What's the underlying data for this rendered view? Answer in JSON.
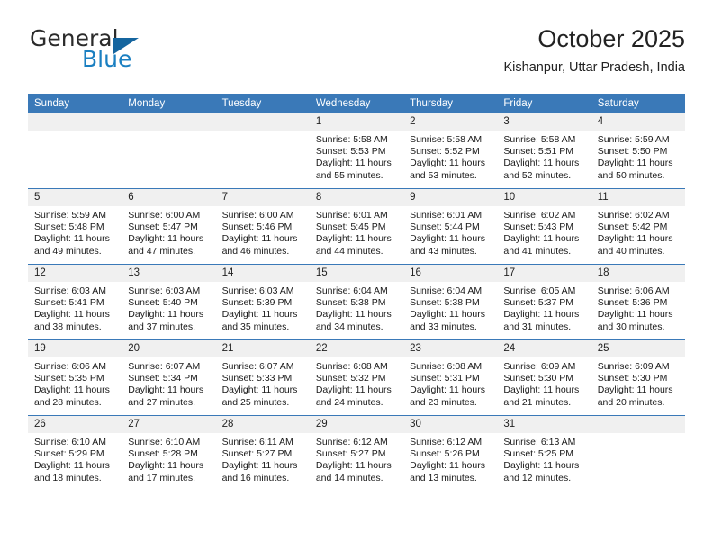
{
  "brand": {
    "name_top": "General",
    "name_bottom": "Blue",
    "triangle_icon": "triangle-logo-icon",
    "color_blue": "#1a7fc1",
    "color_dark": "#2b2b2b"
  },
  "header": {
    "title": "October 2025",
    "location": "Kishanpur, Uttar Pradesh, India"
  },
  "theme": {
    "header_bg": "#3a79b8",
    "daynum_bg": "#f0f0f0",
    "grid_line": "#3a79b8",
    "text": "#1a1a1a"
  },
  "weekday_headers": [
    "Sunday",
    "Monday",
    "Tuesday",
    "Wednesday",
    "Thursday",
    "Friday",
    "Saturday"
  ],
  "labels": {
    "sunrise_prefix": "Sunrise:",
    "sunset_prefix": "Sunset:",
    "daylight_prefix": "Daylight:"
  },
  "weeks": [
    [
      {
        "day": "",
        "sunrise": "",
        "sunset": "",
        "daylight": "",
        "empty": true
      },
      {
        "day": "",
        "sunrise": "",
        "sunset": "",
        "daylight": "",
        "empty": true
      },
      {
        "day": "",
        "sunrise": "",
        "sunset": "",
        "daylight": "",
        "empty": true
      },
      {
        "day": "1",
        "sunrise": "Sunrise: 5:58 AM",
        "sunset": "Sunset: 5:53 PM",
        "daylight": "Daylight: 11 hours and 55 minutes.",
        "empty": false
      },
      {
        "day": "2",
        "sunrise": "Sunrise: 5:58 AM",
        "sunset": "Sunset: 5:52 PM",
        "daylight": "Daylight: 11 hours and 53 minutes.",
        "empty": false
      },
      {
        "day": "3",
        "sunrise": "Sunrise: 5:58 AM",
        "sunset": "Sunset: 5:51 PM",
        "daylight": "Daylight: 11 hours and 52 minutes.",
        "empty": false
      },
      {
        "day": "4",
        "sunrise": "Sunrise: 5:59 AM",
        "sunset": "Sunset: 5:50 PM",
        "daylight": "Daylight: 11 hours and 50 minutes.",
        "empty": false
      }
    ],
    [
      {
        "day": "5",
        "sunrise": "Sunrise: 5:59 AM",
        "sunset": "Sunset: 5:48 PM",
        "daylight": "Daylight: 11 hours and 49 minutes.",
        "empty": false
      },
      {
        "day": "6",
        "sunrise": "Sunrise: 6:00 AM",
        "sunset": "Sunset: 5:47 PM",
        "daylight": "Daylight: 11 hours and 47 minutes.",
        "empty": false
      },
      {
        "day": "7",
        "sunrise": "Sunrise: 6:00 AM",
        "sunset": "Sunset: 5:46 PM",
        "daylight": "Daylight: 11 hours and 46 minutes.",
        "empty": false
      },
      {
        "day": "8",
        "sunrise": "Sunrise: 6:01 AM",
        "sunset": "Sunset: 5:45 PM",
        "daylight": "Daylight: 11 hours and 44 minutes.",
        "empty": false
      },
      {
        "day": "9",
        "sunrise": "Sunrise: 6:01 AM",
        "sunset": "Sunset: 5:44 PM",
        "daylight": "Daylight: 11 hours and 43 minutes.",
        "empty": false
      },
      {
        "day": "10",
        "sunrise": "Sunrise: 6:02 AM",
        "sunset": "Sunset: 5:43 PM",
        "daylight": "Daylight: 11 hours and 41 minutes.",
        "empty": false
      },
      {
        "day": "11",
        "sunrise": "Sunrise: 6:02 AM",
        "sunset": "Sunset: 5:42 PM",
        "daylight": "Daylight: 11 hours and 40 minutes.",
        "empty": false
      }
    ],
    [
      {
        "day": "12",
        "sunrise": "Sunrise: 6:03 AM",
        "sunset": "Sunset: 5:41 PM",
        "daylight": "Daylight: 11 hours and 38 minutes.",
        "empty": false
      },
      {
        "day": "13",
        "sunrise": "Sunrise: 6:03 AM",
        "sunset": "Sunset: 5:40 PM",
        "daylight": "Daylight: 11 hours and 37 minutes.",
        "empty": false
      },
      {
        "day": "14",
        "sunrise": "Sunrise: 6:03 AM",
        "sunset": "Sunset: 5:39 PM",
        "daylight": "Daylight: 11 hours and 35 minutes.",
        "empty": false
      },
      {
        "day": "15",
        "sunrise": "Sunrise: 6:04 AM",
        "sunset": "Sunset: 5:38 PM",
        "daylight": "Daylight: 11 hours and 34 minutes.",
        "empty": false
      },
      {
        "day": "16",
        "sunrise": "Sunrise: 6:04 AM",
        "sunset": "Sunset: 5:38 PM",
        "daylight": "Daylight: 11 hours and 33 minutes.",
        "empty": false
      },
      {
        "day": "17",
        "sunrise": "Sunrise: 6:05 AM",
        "sunset": "Sunset: 5:37 PM",
        "daylight": "Daylight: 11 hours and 31 minutes.",
        "empty": false
      },
      {
        "day": "18",
        "sunrise": "Sunrise: 6:06 AM",
        "sunset": "Sunset: 5:36 PM",
        "daylight": "Daylight: 11 hours and 30 minutes.",
        "empty": false
      }
    ],
    [
      {
        "day": "19",
        "sunrise": "Sunrise: 6:06 AM",
        "sunset": "Sunset: 5:35 PM",
        "daylight": "Daylight: 11 hours and 28 minutes.",
        "empty": false
      },
      {
        "day": "20",
        "sunrise": "Sunrise: 6:07 AM",
        "sunset": "Sunset: 5:34 PM",
        "daylight": "Daylight: 11 hours and 27 minutes.",
        "empty": false
      },
      {
        "day": "21",
        "sunrise": "Sunrise: 6:07 AM",
        "sunset": "Sunset: 5:33 PM",
        "daylight": "Daylight: 11 hours and 25 minutes.",
        "empty": false
      },
      {
        "day": "22",
        "sunrise": "Sunrise: 6:08 AM",
        "sunset": "Sunset: 5:32 PM",
        "daylight": "Daylight: 11 hours and 24 minutes.",
        "empty": false
      },
      {
        "day": "23",
        "sunrise": "Sunrise: 6:08 AM",
        "sunset": "Sunset: 5:31 PM",
        "daylight": "Daylight: 11 hours and 23 minutes.",
        "empty": false
      },
      {
        "day": "24",
        "sunrise": "Sunrise: 6:09 AM",
        "sunset": "Sunset: 5:30 PM",
        "daylight": "Daylight: 11 hours and 21 minutes.",
        "empty": false
      },
      {
        "day": "25",
        "sunrise": "Sunrise: 6:09 AM",
        "sunset": "Sunset: 5:30 PM",
        "daylight": "Daylight: 11 hours and 20 minutes.",
        "empty": false
      }
    ],
    [
      {
        "day": "26",
        "sunrise": "Sunrise: 6:10 AM",
        "sunset": "Sunset: 5:29 PM",
        "daylight": "Daylight: 11 hours and 18 minutes.",
        "empty": false
      },
      {
        "day": "27",
        "sunrise": "Sunrise: 6:10 AM",
        "sunset": "Sunset: 5:28 PM",
        "daylight": "Daylight: 11 hours and 17 minutes.",
        "empty": false
      },
      {
        "day": "28",
        "sunrise": "Sunrise: 6:11 AM",
        "sunset": "Sunset: 5:27 PM",
        "daylight": "Daylight: 11 hours and 16 minutes.",
        "empty": false
      },
      {
        "day": "29",
        "sunrise": "Sunrise: 6:12 AM",
        "sunset": "Sunset: 5:27 PM",
        "daylight": "Daylight: 11 hours and 14 minutes.",
        "empty": false
      },
      {
        "day": "30",
        "sunrise": "Sunrise: 6:12 AM",
        "sunset": "Sunset: 5:26 PM",
        "daylight": "Daylight: 11 hours and 13 minutes.",
        "empty": false
      },
      {
        "day": "31",
        "sunrise": "Sunrise: 6:13 AM",
        "sunset": "Sunset: 5:25 PM",
        "daylight": "Daylight: 11 hours and 12 minutes.",
        "empty": false
      },
      {
        "day": "",
        "sunrise": "",
        "sunset": "",
        "daylight": "",
        "empty": true
      }
    ]
  ]
}
